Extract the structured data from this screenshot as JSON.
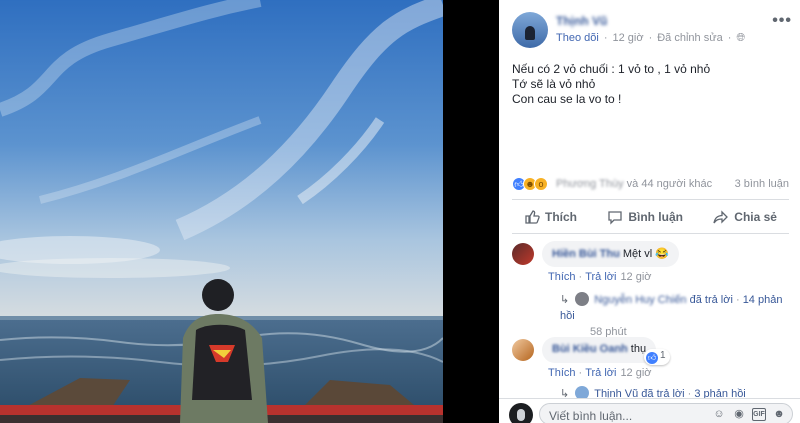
{
  "post": {
    "author_name": "Thịnh Vũ",
    "follow_label": "Theo dõi",
    "time": "12 giờ",
    "edited_label": "Đã chỉnh sửa",
    "more_label": "•••",
    "body_lines": [
      "Nếu có 2 vỏ chuối : 1 vỏ to , 1 vỏ nhỏ",
      "Tớ sẽ là vỏ nhỏ",
      "Con cau se la vo to !"
    ]
  },
  "reactions": {
    "names_blurred": "Phương Thùy",
    "names_rest": " và 44 người khác",
    "comment_count": "3 bình luận"
  },
  "actions": {
    "like": "Thích",
    "comment": "Bình luận",
    "share": "Chia sẻ"
  },
  "comments": [
    {
      "name": "Hiền Bùi Thu",
      "text": "Mệt vl 😂",
      "like_label": "Thích",
      "reply_label": "Trả lời",
      "time": "12 giờ",
      "reply_summary": {
        "name": "Nguyễn Huy Chiến",
        "text_a": " đã trả lời",
        "sep": " · ",
        "count": "14 phản hồi",
        "time": "58 phút"
      }
    },
    {
      "name": "Bùi Kiều Oanh",
      "text": "thụ",
      "like_count": "1",
      "like_label": "Thích",
      "reply_label": "Trả lời",
      "time": "12 giờ",
      "reply_summary": {
        "name": "Thịnh Vũ",
        "text_a": " đã trả lời",
        "sep": " · ",
        "count": "3 phản hồi"
      }
    }
  ],
  "write_comment": {
    "placeholder": "Viết bình luận..."
  },
  "colors": {
    "link_blue": "#385898",
    "fb_blue": "#4267b2",
    "meta_grey": "#90949c",
    "bubble_bg": "#f2f3f5"
  }
}
